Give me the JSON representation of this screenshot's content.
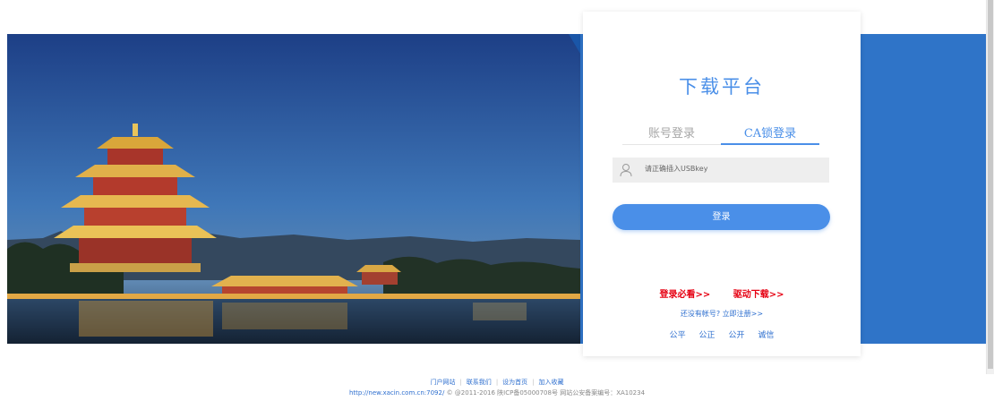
{
  "login_card": {
    "title": "下载平台",
    "tabs": [
      {
        "label": "账号登录",
        "active": false
      },
      {
        "label": "CA锁登录",
        "active": true
      }
    ],
    "usbkey_hint": "请正确插入USBkey",
    "login_button": "登录",
    "must_read_link": "登录必看>>",
    "driver_download_link": "驱动下载>>",
    "register_link": "还没有帐号? 立即注册>>",
    "values": [
      "公平",
      "公正",
      "公开",
      "诚信"
    ]
  },
  "footer": {
    "links": [
      "门户网站",
      "联系我们",
      "设为首页",
      "加入收藏"
    ],
    "url": "http://new.xacin.com.cn:7092/",
    "copyright": "© @2011-2016 陕ICP备05000708号 网站公安备案编号：XA10234"
  },
  "colors": {
    "accent": "#4a8fe8",
    "banner_blue": "#2f74c8",
    "link_red": "#e60012"
  }
}
